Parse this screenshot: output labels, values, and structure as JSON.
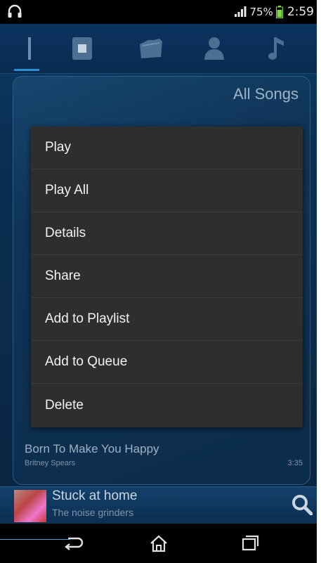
{
  "status_bar": {
    "battery_percent": "75%",
    "time": "2:59"
  },
  "tabs": [
    {
      "icon": "now-playing-icon"
    },
    {
      "icon": "album-icon"
    },
    {
      "icon": "folder-icon"
    },
    {
      "icon": "artist-icon"
    },
    {
      "icon": "music-note-icon"
    }
  ],
  "list": {
    "section_title": "All Songs",
    "visible_song": {
      "title": "Born To Make You Happy",
      "artist": "Britney Spears",
      "duration": "3:35"
    }
  },
  "context_menu": {
    "items": [
      "Play",
      "Play All",
      "Details",
      "Share",
      "Add to Playlist",
      "Add to Queue",
      "Delete"
    ]
  },
  "now_playing": {
    "title": "Stuck at home",
    "artist": "The noise grinders"
  },
  "colors": {
    "accent": "#2a8fd0",
    "menu_bg": "#2e2e2e"
  }
}
